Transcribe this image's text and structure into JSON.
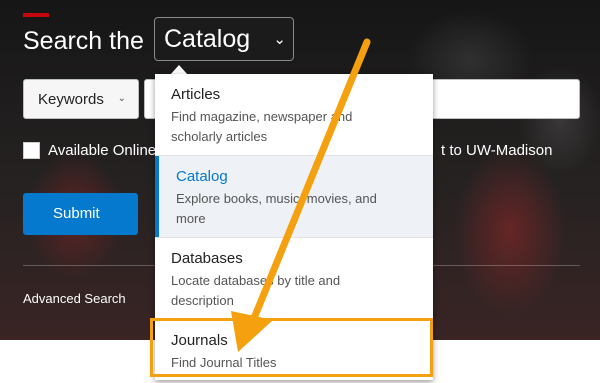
{
  "header": {
    "heading": "Search the",
    "type_value": "Catalog"
  },
  "search": {
    "field_value": "Keywords",
    "query_value": ""
  },
  "filter": {
    "label": "Available Online",
    "label_tail": "t to UW-Madison"
  },
  "submit": {
    "label": "Submit"
  },
  "advanced": {
    "label": "Advanced Search"
  },
  "dropdown": {
    "options": [
      {
        "title": "Articles",
        "desc": "Find magazine, newspaper and scholarly articles"
      },
      {
        "title": "Catalog",
        "desc": "Explore books, music, movies, and more"
      },
      {
        "title": "Databases",
        "desc": "Locate databases by title and description"
      },
      {
        "title": "Journals",
        "desc": "Find Journal Titles"
      }
    ],
    "selected_index": 1,
    "highlighted_index": 3
  },
  "colors": {
    "accent": "#c5050c",
    "primary": "#0479ce",
    "annotation": "#f5a10f"
  },
  "icons": {
    "type_chevron": "chevron-down-icon",
    "field_chevron": "chevron-down-icon"
  }
}
